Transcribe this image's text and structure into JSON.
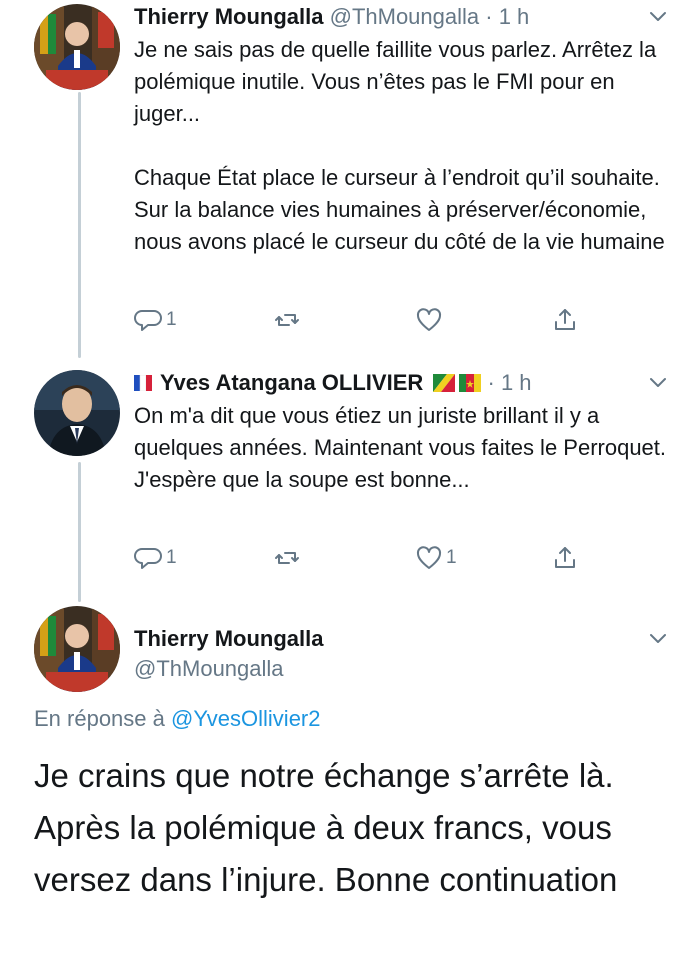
{
  "tweet1": {
    "name": "Thierry Moungalla",
    "handle": "@ThMoungalla",
    "time": "· 1 h",
    "text": "Je ne sais pas de quelle faillite vous parlez. Arrêtez la polémique inutile. Vous n’êtes pas le FMI pour en juger...\n\nChaque État place le curseur à l’endroit qu’il souhaite. Sur la balance vies humaines à préserver/économie, nous avons placé le curseur du côté de la vie humaine",
    "reply_count": "1",
    "like_count": ""
  },
  "tweet2": {
    "name": "Yves Atangana OLLIVIER",
    "time": "· 1 h",
    "text": "On m'a dit que vous étiez un juriste brillant il y a quelques années. Maintenant vous faites le Perroquet. J'espère que la soupe est bonne...",
    "reply_count": "1",
    "like_count": "1"
  },
  "tweet3": {
    "name": "Thierry Moungalla",
    "handle": "@ThMoungalla",
    "reply_prefix": "En réponse à",
    "reply_handle": "@YvesOllivier2",
    "text": "Je crains que notre échange s’arrête là. Après la polémique à deux francs, vous versez dans l’injure. Bonne continuation"
  },
  "icons": {
    "reply": "reply-icon",
    "retweet": "retweet-icon",
    "like": "heart-icon",
    "share": "share-icon",
    "more": "chevron-down-icon"
  },
  "colors": {
    "link": "#1b95e0",
    "secondary_text": "#657786",
    "thread_line": "#c4cfd6"
  }
}
